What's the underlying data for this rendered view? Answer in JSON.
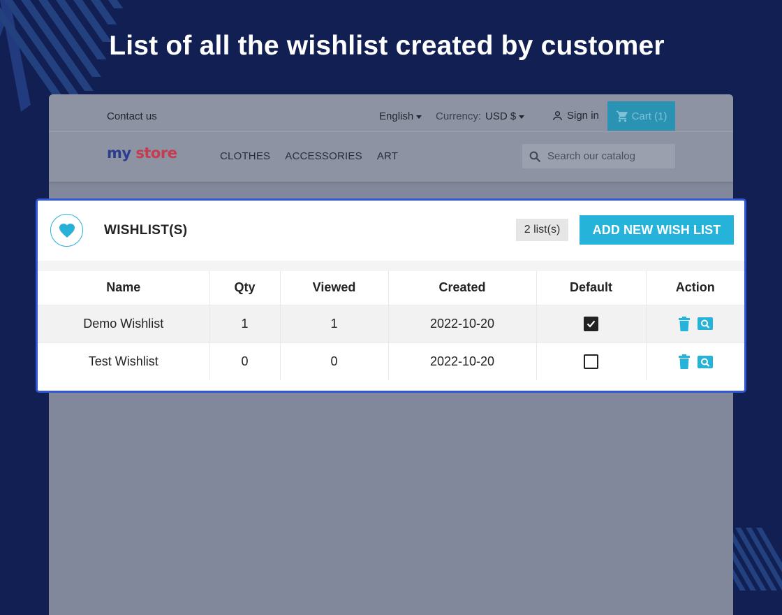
{
  "banner": {
    "title": "List of all the wishlist created by customer"
  },
  "store": {
    "topbar": {
      "contact": "Contact us",
      "language": "English",
      "currency_label": "Currency:",
      "currency_value": "USD $",
      "signin": "Sign in",
      "cart": "Cart (1)"
    },
    "logo": {
      "word1": "my",
      "word2": "store"
    },
    "nav": [
      "CLOTHES",
      "ACCESSORIES",
      "ART"
    ],
    "search": {
      "placeholder": "Search our catalog"
    }
  },
  "wishlist": {
    "title": "WISHLIST(S)",
    "count_badge": "2 list(s)",
    "add_button": "ADD NEW WISH LIST",
    "columns": [
      "Name",
      "Qty",
      "Viewed",
      "Created",
      "Default",
      "Action"
    ],
    "rows": [
      {
        "name": "Demo Wishlist",
        "qty": "1",
        "viewed": "1",
        "created": "2022-10-20",
        "default": true
      },
      {
        "name": "Test Wishlist",
        "qty": "0",
        "viewed": "0",
        "created": "2022-10-20",
        "default": false
      }
    ]
  },
  "colors": {
    "background": "#111f52",
    "accent": "#25b3d9",
    "highlight_border": "#2f57d8"
  },
  "icons": [
    "heart-icon",
    "user-icon",
    "cart-icon",
    "search-icon",
    "trash-icon",
    "view-icon",
    "checkbox-checked-icon",
    "checkbox-empty-icon"
  ]
}
